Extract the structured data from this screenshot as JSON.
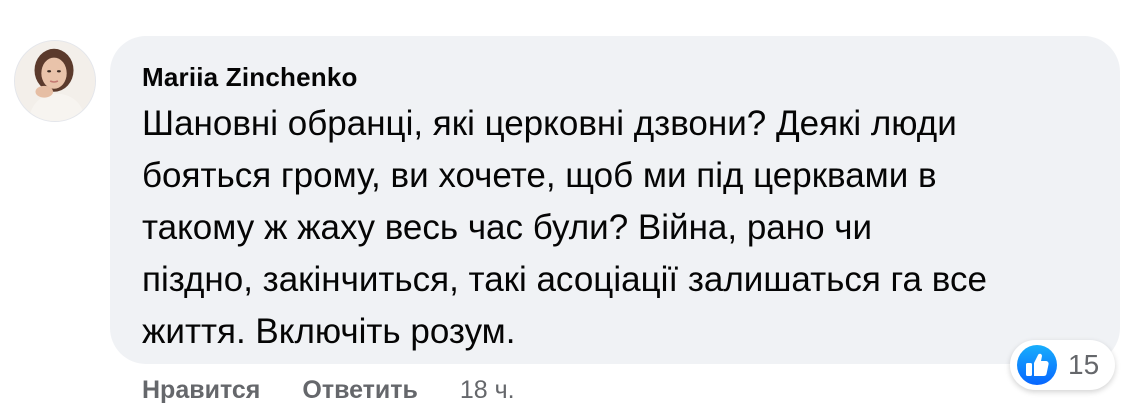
{
  "comment": {
    "author": "Mariia Zinchenko",
    "text": "Шановні обранці, які церковні дзвони? Деякі люди\nбояться грому, ви хочете, щоб ми під церквами в\nтакому ж жаху весь час були? Війна, рано чи\nпіздно, закінчиться, такі асоціації залишаться га все\nжиття. Включіть розум.",
    "avatar_icon": "user-avatar-photo"
  },
  "reactions": {
    "icon": "like-thumbs-up-icon",
    "color": "#1877f2",
    "count": "15"
  },
  "actions": {
    "like_label": "Нравится",
    "reply_label": "Ответить",
    "timestamp": "18 ч."
  }
}
